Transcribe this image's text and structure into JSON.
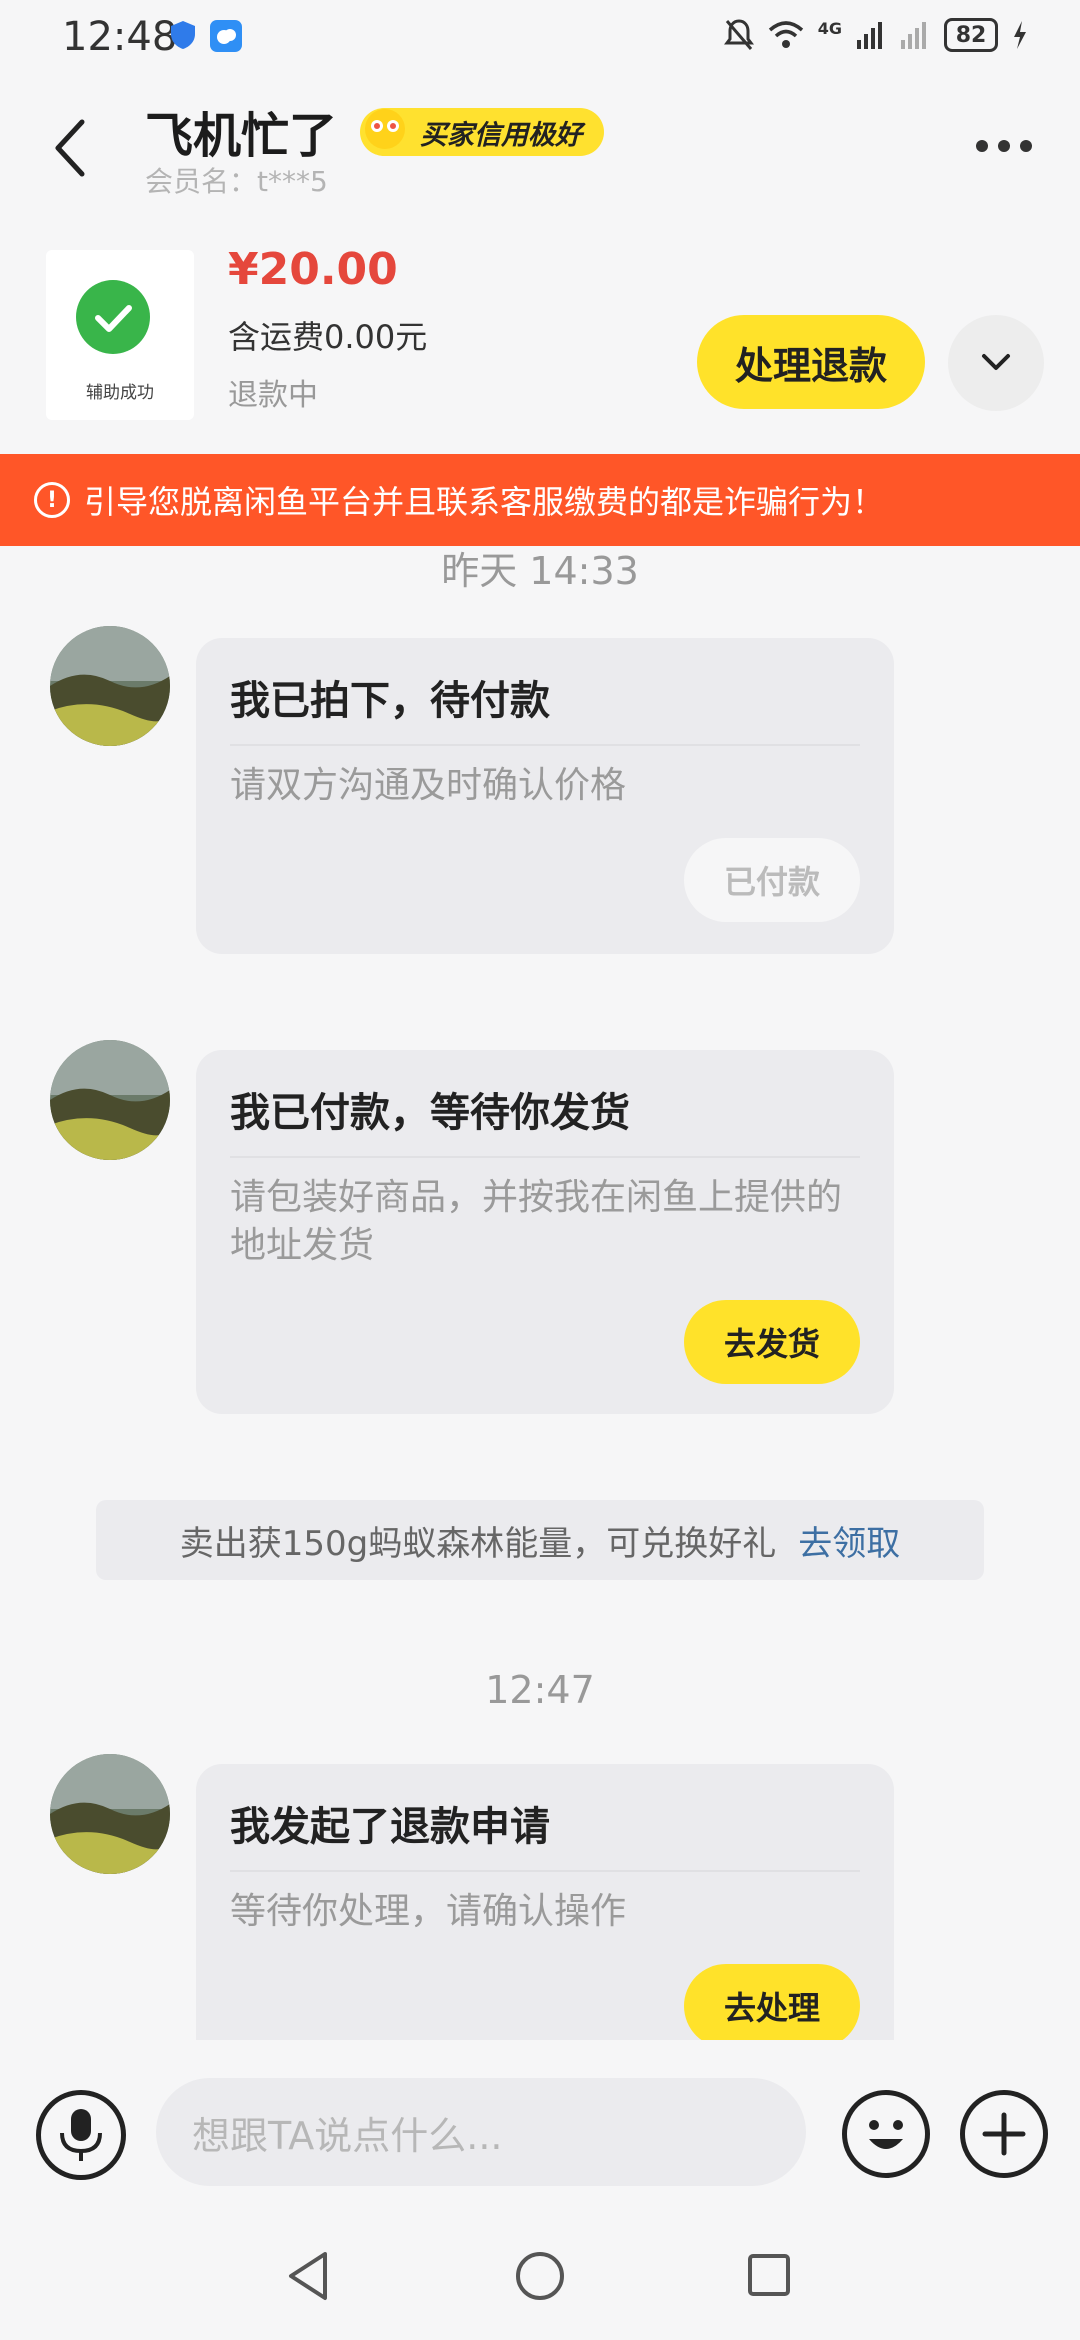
{
  "status_bar": {
    "time": "12:48",
    "battery": "82",
    "network": "4G"
  },
  "header": {
    "title": "飞机忙了",
    "badge": "买家信用极好",
    "member": "会员名：t***5"
  },
  "order": {
    "thumb_label": "辅助成功",
    "price": "¥20.00",
    "shipping": "含运费0.00元",
    "status": "退款中",
    "refund_button": "处理退款"
  },
  "warning": {
    "text": "引导您脱离闲鱼平台并且联系客服缴费的都是诈骗行为！"
  },
  "chat": {
    "timestamp1": "昨天 14:33",
    "msg1": {
      "title": "我已拍下，待付款",
      "subtitle": "请双方沟通及时确认价格",
      "button": "已付款"
    },
    "msg2": {
      "title": "我已付款，等待你发货",
      "subtitle": "请包装好商品，并按我在闲鱼上提供的地址发货",
      "button": "去发货"
    },
    "promo": {
      "text": "卖出获150g蚂蚁森林能量，可兑换好礼",
      "link": "去领取"
    },
    "timestamp2": "12:47",
    "msg3": {
      "title": "我发起了退款申请",
      "subtitle": "等待你处理，请确认操作",
      "button": "去处理"
    }
  },
  "input": {
    "placeholder": "想跟TA说点什么..."
  },
  "colors": {
    "accent": "#ffe22a",
    "warning": "#ff5628",
    "price": "#e5473c",
    "link": "#3d6fa3"
  },
  "icons": [
    "shield-icon",
    "weather-icon",
    "mute-icon",
    "wifi-icon",
    "signal-icon",
    "battery-icon",
    "back-icon",
    "more-icon",
    "check-icon",
    "chevron-down-icon",
    "warning-icon",
    "mic-icon",
    "emoji-icon",
    "plus-icon",
    "nav-back-icon",
    "nav-home-icon",
    "nav-recent-icon"
  ]
}
